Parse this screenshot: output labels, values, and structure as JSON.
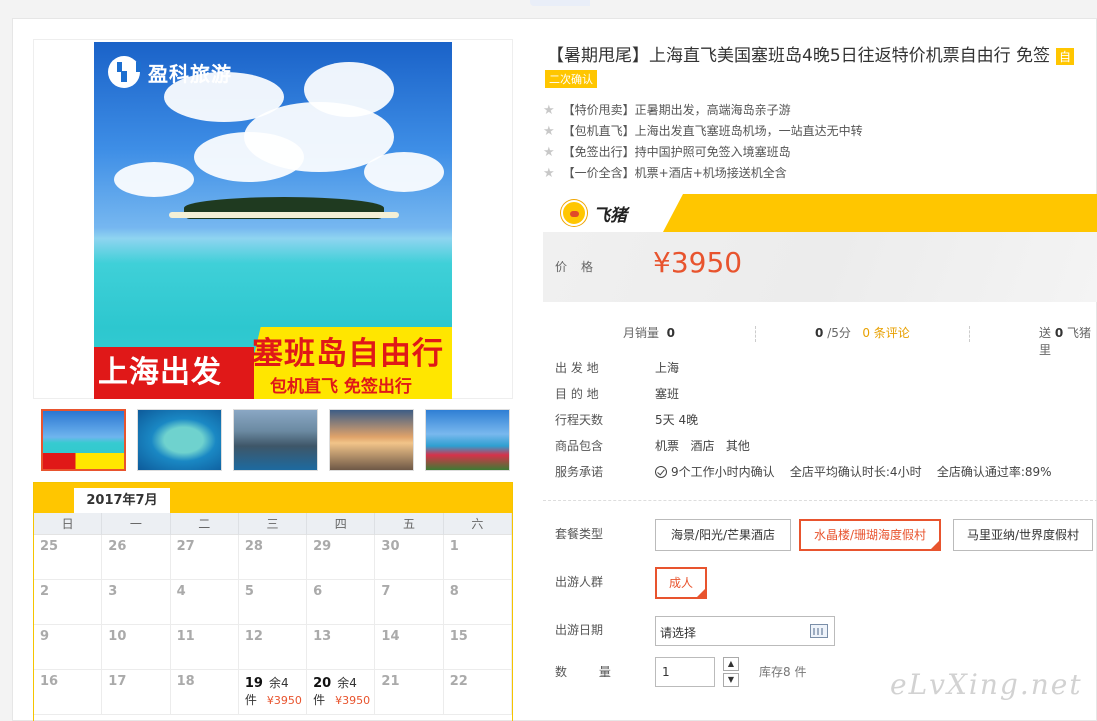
{
  "brand": {
    "logo_text": "盈科旅游",
    "banner_left": "上海出发",
    "banner_title": "塞班岛自由行",
    "banner_sub": "包机直飞 免签出行"
  },
  "product": {
    "title": "【暑期甩尾】上海直飞美国塞班岛4晚5日往返特价机票自由行 免签",
    "title_tag": "自",
    "confirm_tag": "二次确认",
    "features": [
      "【特价甩卖】正暑期出发，高端海岛亲子游",
      "【包机直飞】上海出发直飞塞班岛机场，一站直达无中转",
      "【免签出行】持中国护照可免签入境塞班岛",
      "【一价全含】机票+酒店+机场接送机全含"
    ]
  },
  "platform": {
    "name": "飞猪"
  },
  "price": {
    "label": "价格",
    "value": "¥3950"
  },
  "stats": {
    "monthly_sales_label": "月销量",
    "monthly_sales": "0",
    "rating": "0",
    "rating_suffix": "/5分",
    "reviews": "0 条评论",
    "gift_prefix": "送",
    "gift_value": "0",
    "gift_suffix": "飞猪里"
  },
  "info": [
    {
      "label": "出 发 地",
      "value": "上海"
    },
    {
      "label": "目 的 地",
      "value": "塞班"
    },
    {
      "label": "行程天数",
      "value": "5天 4晚"
    },
    {
      "label": "商品包含",
      "value": "机票   酒店   其他"
    },
    {
      "label": "服务承诺",
      "value": "9个工作小时内确认    全店平均确认时长:4小时    全店确认通过率:89%"
    }
  ],
  "options": {
    "package_label": "套餐类型",
    "packages": [
      "海景/阳光/芒果酒店",
      "水晶楼/珊瑚海度假村",
      "马里亚纳/世界度假村"
    ],
    "selected_package": "水晶楼/珊瑚海度假村",
    "crowd_label": "出游人群",
    "crowd": "成人",
    "date_label": "出游日期",
    "date_placeholder": "请选择",
    "qty_label": "数 量",
    "qty": "1",
    "stock": "库存8 件"
  },
  "calendar": {
    "month": "2017年7月",
    "weekdays": [
      "日",
      "一",
      "二",
      "三",
      "四",
      "五",
      "六"
    ],
    "rows": [
      [
        "25",
        "26",
        "27",
        "28",
        "29",
        "30",
        "1"
      ],
      [
        "2",
        "3",
        "4",
        "5",
        "6",
        "7",
        "8"
      ],
      [
        "9",
        "10",
        "11",
        "12",
        "13",
        "14",
        "15"
      ],
      [
        "16",
        "17",
        "18",
        "19",
        "20",
        "21",
        "22"
      ]
    ],
    "available": [
      {
        "day": "19",
        "stock": "余4件",
        "price": "¥3950"
      },
      {
        "day": "20",
        "stock": "余4件",
        "price": "¥3950"
      }
    ]
  },
  "watermark": "eLvXing.net",
  "colors": {
    "accent": "#e8542e",
    "brand_yellow": "#ffc600"
  }
}
